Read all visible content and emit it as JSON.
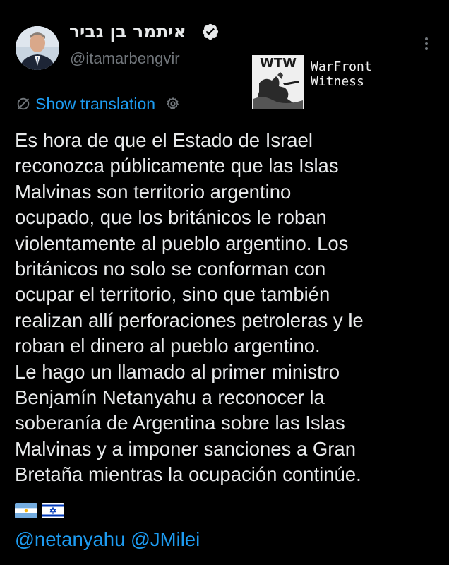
{
  "author": {
    "display_name": "איתמר בן גביר",
    "handle": "@itamarbengvir",
    "verified_icon": "verified-badge-icon",
    "avatar_icon": "user-avatar"
  },
  "watermark": {
    "logo_text": "WTW",
    "line1": "WarFront",
    "line2": "Witness"
  },
  "translation": {
    "icon": "globe-slash-icon",
    "label": "Show translation",
    "settings_icon": "gear-icon"
  },
  "tweet": {
    "lines": [
      "Es hora de que el Estado de Israel",
      "reconozca públicamente que las Islas",
      "Malvinas son territorio argentino",
      "ocupado, que los británicos le roban",
      "violentamente al pueblo argentino. Los",
      "británicos no solo se conforman con",
      "ocupar el territorio, sino que también",
      "realizan allí perforaciones petroleras y le",
      "roban el dinero al pueblo argentino.",
      "Le hago un llamado al primer ministro",
      "Benjamín Netanyahu a reconocer la",
      "soberanía de Argentina sobre las Islas",
      "Malvinas y a imponer sanciones a Gran",
      "Bretaña mientras la ocupación continúe."
    ],
    "flags": [
      "argentina-flag-icon",
      "israel-flag-icon"
    ],
    "mentions": [
      "@netanyahu",
      "@JMilei"
    ]
  },
  "colors": {
    "background": "#000000",
    "text": "#e7e9ea",
    "secondary": "#71767b",
    "link": "#1d9bf0"
  }
}
